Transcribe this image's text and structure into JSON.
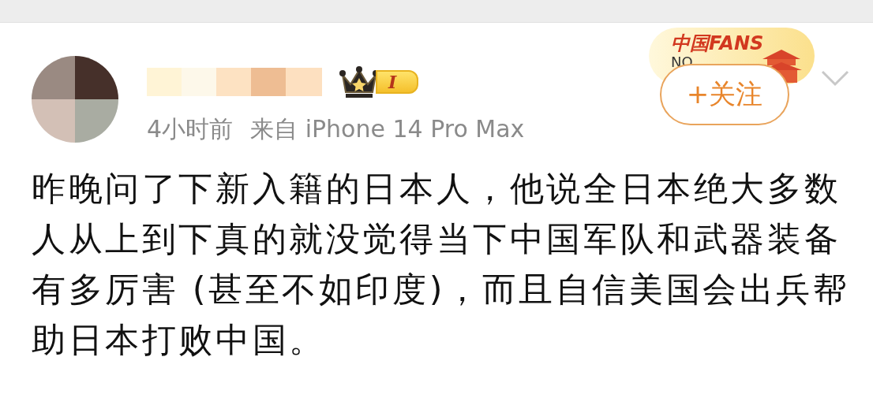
{
  "post": {
    "fan_card": {
      "title": "中国FANS",
      "number": "NO"
    },
    "fan_badge": {
      "level": "I"
    },
    "time": "4小时前",
    "source": "来自 iPhone 14 Pro Max",
    "follow_button": "+关注",
    "text": "昨晚问了下新入籍的日本人，他说全日本绝大多数人从上到下真的就没觉得当下中国军队和武器装备有多厉害 (甚至不如印度)，而且自信美国会出兵帮助日本打败中国。"
  }
}
